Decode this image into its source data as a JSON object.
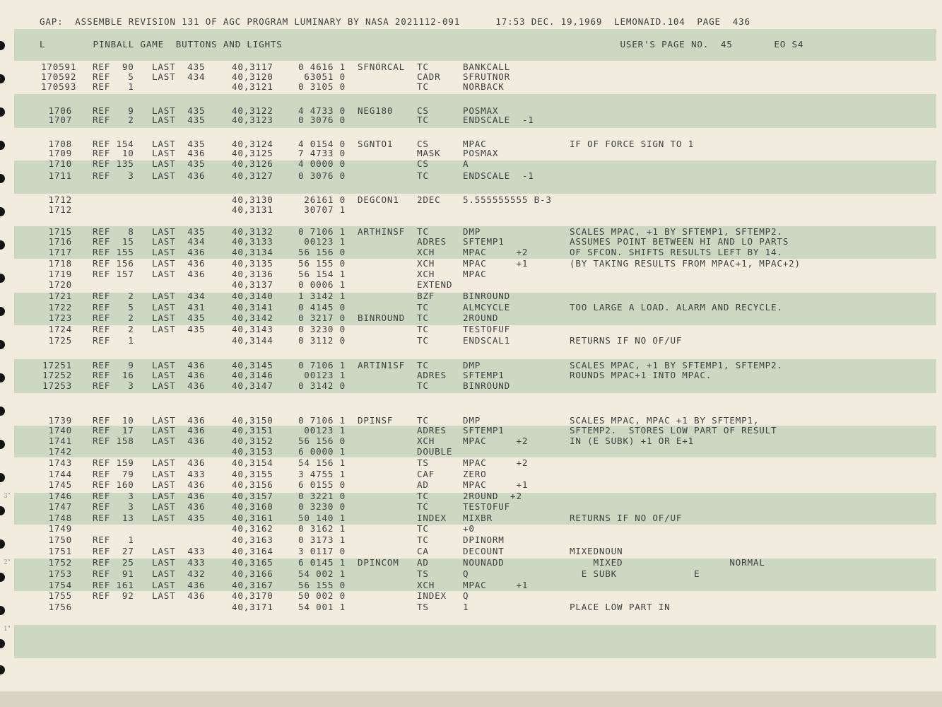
{
  "header": {
    "line": "GAP:  ASSEMBLE REVISION 131 OF AGC PROGRAM LUMINARY BY NASA 2021112-091      17:53 DEC. 19,1969  LEMONAID.104  PAGE  436"
  },
  "subheader": {
    "line": "L        PINBALL GAME  BUTTONS AND LIGHTS                                                         USER'S PAGE NO.  45       EO S4"
  },
  "rows": [
    {
      "seq": "170591",
      "ref": "REF  90",
      "last": "LAST  435",
      "addr": "40,3117",
      "code": "0 4616 1",
      "label": "SFNORCAL",
      "op": "TC",
      "operand": "BANKCALL",
      "comment": ""
    },
    {
      "seq": "170592",
      "ref": "REF   5",
      "last": "LAST  434",
      "addr": "40,3120",
      "code": "  63051 0",
      "label": "",
      "op": "CADR",
      "operand": "SFRUTNOR",
      "comment": ""
    },
    {
      "seq": "170593",
      "ref": "REF   1",
      "last": "",
      "addr": "40,3121",
      "code": "0 3105 0",
      "label": "",
      "op": "TC",
      "operand": "NORBACK",
      "comment": ""
    },
    {
      "seq": "1706",
      "ref": "REF   9",
      "last": "LAST  435",
      "addr": "40,3122",
      "code": "4 4733 0",
      "label": "NEG180",
      "op": "CS",
      "operand": "POSMAX",
      "comment": ""
    },
    {
      "seq": "1707",
      "ref": "REF   2",
      "last": "LAST  435",
      "addr": "40,3123",
      "code": "0 3076 0",
      "label": "",
      "op": "TC",
      "operand": "ENDSCALE  -1",
      "comment": ""
    },
    {
      "seq": "1708",
      "ref": "REF 154",
      "last": "LAST  435",
      "addr": "40,3124",
      "code": "4 0154 0",
      "label": "SGNTO1",
      "op": "CS",
      "operand": "MPAC",
      "comment": "IF OF FORCE SIGN TO 1"
    },
    {
      "seq": "1709",
      "ref": "REF  10",
      "last": "LAST  436",
      "addr": "40,3125",
      "code": "7 4733 0",
      "label": "",
      "op": "MASK",
      "operand": "POSMAX",
      "comment": ""
    },
    {
      "seq": "1710",
      "ref": "REF 135",
      "last": "LAST  435",
      "addr": "40,3126",
      "code": "4 0000 0",
      "label": "",
      "op": "CS",
      "operand": "A",
      "comment": ""
    },
    {
      "seq": "1711",
      "ref": "REF   3",
      "last": "LAST  436",
      "addr": "40,3127",
      "code": "0 3076 0",
      "label": "",
      "op": "TC",
      "operand": "ENDSCALE  -1",
      "comment": ""
    },
    {
      "seq": "1712",
      "ref": "",
      "last": "",
      "addr": "40,3130",
      "code": "  26161 0",
      "label": "DEGCON1",
      "op": "2DEC",
      "operand": "5.555555555 B-3",
      "comment": ""
    },
    {
      "seq": "1712",
      "ref": "",
      "last": "",
      "addr": "40,3131",
      "code": "  30707 1",
      "label": "",
      "op": "",
      "operand": "",
      "comment": ""
    },
    {
      "seq": "1715",
      "ref": "REF   8",
      "last": "LAST  435",
      "addr": "40,3132",
      "code": "0 7106 1",
      "label": "ARTHINSF",
      "op": "TC",
      "operand": "DMP",
      "comment": "SCALES MPAC, +1 BY SFTEMP1, SFTEMP2."
    },
    {
      "seq": "1716",
      "ref": "REF  15",
      "last": "LAST  434",
      "addr": "40,3133",
      "code": "  00123 1",
      "label": "",
      "op": "ADRES",
      "operand": "SFTEMP1",
      "comment": "ASSUMES POINT BETWEEN HI AND LO PARTS"
    },
    {
      "seq": "1717",
      "ref": "REF 155",
      "last": "LAST  436",
      "addr": "40,3134",
      "code": "56 156 0",
      "label": "",
      "op": "XCH",
      "operand": "MPAC     +2",
      "comment": "OF SFCON. SHIFTS RESULTS LEFT BY 14."
    },
    {
      "seq": "1718",
      "ref": "REF 156",
      "last": "LAST  436",
      "addr": "40,3135",
      "code": "56 155 0",
      "label": "",
      "op": "XCH",
      "operand": "MPAC     +1",
      "comment": "(BY TAKING RESULTS FROM MPAC+1, MPAC+2)"
    },
    {
      "seq": "1719",
      "ref": "REF 157",
      "last": "LAST  436",
      "addr": "40,3136",
      "code": "56 154 1",
      "label": "",
      "op": "XCH",
      "operand": "MPAC",
      "comment": ""
    },
    {
      "seq": "1720",
      "ref": "",
      "last": "",
      "addr": "40,3137",
      "code": "0 0006 1",
      "label": "",
      "op": "EXTEND",
      "operand": "",
      "comment": ""
    },
    {
      "seq": "1721",
      "ref": "REF   2",
      "last": "LAST  434",
      "addr": "40,3140",
      "code": "1 3142 1",
      "label": "",
      "op": "BZF",
      "operand": "BINROUND",
      "comment": ""
    },
    {
      "seq": "1722",
      "ref": "REF   5",
      "last": "LAST  431",
      "addr": "40,3141",
      "code": "0 4145 0",
      "label": "",
      "op": "TC",
      "operand": "ALMCYCLE",
      "comment": "TOO LARGE A LOAD. ALARM AND RECYCLE."
    },
    {
      "seq": "1723",
      "ref": "REF   2",
      "last": "LAST  435",
      "addr": "40,3142",
      "code": "0 3217 0",
      "label": "BINROUND",
      "op": "TC",
      "operand": "2ROUND",
      "comment": ""
    },
    {
      "seq": "1724",
      "ref": "REF   2",
      "last": "LAST  435",
      "addr": "40,3143",
      "code": "0 3230 0",
      "label": "",
      "op": "TC",
      "operand": "TESTOFUF",
      "comment": ""
    },
    {
      "seq": "1725",
      "ref": "REF   1",
      "last": "",
      "addr": "40,3144",
      "code": "0 3112 0",
      "label": "",
      "op": "TC",
      "operand": "ENDSCAL1",
      "comment": "RETURNS IF NO OF/UF"
    },
    {
      "seq": "17251",
      "ref": "REF   9",
      "last": "LAST  436",
      "addr": "40,3145",
      "code": "0 7106 1",
      "label": "ARTIN1SF",
      "op": "TC",
      "operand": "DMP",
      "comment": "SCALES MPAC, +1 BY SFTEMP1, SFTEMP2."
    },
    {
      "seq": "17252",
      "ref": "REF  16",
      "last": "LAST  436",
      "addr": "40,3146",
      "code": "  00123 1",
      "label": "",
      "op": "ADRES",
      "operand": "SFTEMP1",
      "comment": "ROUNDS MPAC+1 INTO MPAC."
    },
    {
      "seq": "17253",
      "ref": "REF   3",
      "last": "LAST  436",
      "addr": "40,3147",
      "code": "0 3142 0",
      "label": "",
      "op": "TC",
      "operand": "BINROUND",
      "comment": ""
    },
    {
      "seq": "1739",
      "ref": "REF  10",
      "last": "LAST  436",
      "addr": "40,3150",
      "code": "0 7106 1",
      "label": "DPINSF",
      "op": "TC",
      "operand": "DMP",
      "comment": "SCALES MPAC, MPAC +1 BY SFTEMP1,"
    },
    {
      "seq": "1740",
      "ref": "REF  17",
      "last": "LAST  436",
      "addr": "40,3151",
      "code": "  00123 1",
      "label": "",
      "op": "ADRES",
      "operand": "SFTEMP1",
      "comment": "SFTEMP2.  STORES LOW PART OF RESULT"
    },
    {
      "seq": "1741",
      "ref": "REF 158",
      "last": "LAST  436",
      "addr": "40,3152",
      "code": "56 156 0",
      "label": "",
      "op": "XCH",
      "operand": "MPAC     +2",
      "comment": "IN (E SUBK) +1 OR E+1"
    },
    {
      "seq": "1742",
      "ref": "",
      "last": "",
      "addr": "40,3153",
      "code": "6 0000 1",
      "label": "",
      "op": "DOUBLE",
      "operand": "",
      "comment": ""
    },
    {
      "seq": "1743",
      "ref": "REF 159",
      "last": "LAST  436",
      "addr": "40,3154",
      "code": "54 156 1",
      "label": "",
      "op": "TS",
      "operand": "MPAC     +2",
      "comment": ""
    },
    {
      "seq": "1744",
      "ref": "REF  79",
      "last": "LAST  433",
      "addr": "40,3155",
      "code": "3 4755 1",
      "label": "",
      "op": "CAF",
      "operand": "ZERO",
      "comment": ""
    },
    {
      "seq": "1745",
      "ref": "REF 160",
      "last": "LAST  436",
      "addr": "40,3156",
      "code": "6 0155 0",
      "label": "",
      "op": "AD",
      "operand": "MPAC     +1",
      "comment": ""
    },
    {
      "seq": "1746",
      "ref": "REF   3",
      "last": "LAST  436",
      "addr": "40,3157",
      "code": "0 3221 0",
      "label": "",
      "op": "TC",
      "operand": "2ROUND  +2",
      "comment": ""
    },
    {
      "seq": "1747",
      "ref": "REF   3",
      "last": "LAST  436",
      "addr": "40,3160",
      "code": "0 3230 0",
      "label": "",
      "op": "TC",
      "operand": "TESTOFUF",
      "comment": ""
    },
    {
      "seq": "1748",
      "ref": "REF  13",
      "last": "LAST  435",
      "addr": "40,3161",
      "code": "50 140 1",
      "label": "",
      "op": "INDEX",
      "operand": "MIXBR",
      "comment": "RETURNS IF NO OF/UF"
    },
    {
      "seq": "1749",
      "ref": "",
      "last": "",
      "addr": "40,3162",
      "code": "0 3162 1",
      "label": "",
      "op": "TC",
      "operand": "+0",
      "comment": ""
    },
    {
      "seq": "1750",
      "ref": "REF   1",
      "last": "",
      "addr": "40,3163",
      "code": "0 3173 1",
      "label": "",
      "op": "TC",
      "operand": "DPINORM",
      "comment": ""
    },
    {
      "seq": "1751",
      "ref": "REF  27",
      "last": "LAST  433",
      "addr": "40,3164",
      "code": "3 0117 0",
      "label": "",
      "op": "CA",
      "operand": "DECOUNT",
      "comment": "MIXEDNOUN"
    },
    {
      "seq": "1752",
      "ref": "REF  25",
      "last": "LAST  433",
      "addr": "40,3165",
      "code": "6 0145 1",
      "label": "DPINCOM",
      "op": "AD",
      "operand": "NOUNADD",
      "comment": "    MIXED                  NORMAL"
    },
    {
      "seq": "1753",
      "ref": "REF  91",
      "last": "LAST  432",
      "addr": "40,3166",
      "code": "54 002 1",
      "label": "",
      "op": "TS",
      "operand": "Q",
      "comment": "  E SUBK             E"
    },
    {
      "seq": "1754",
      "ref": "REF 161",
      "last": "LAST  436",
      "addr": "40,3167",
      "code": "56 155 0",
      "label": "",
      "op": "XCH",
      "operand": "MPAC     +1",
      "comment": ""
    },
    {
      "seq": "1755",
      "ref": "REF  92",
      "last": "LAST  436",
      "addr": "40,3170",
      "code": "50 002 0",
      "label": "",
      "op": "INDEX",
      "operand": "Q",
      "comment": ""
    },
    {
      "seq": "1756",
      "ref": "",
      "last": "",
      "addr": "40,3171",
      "code": "54 001 1",
      "label": "",
      "op": "TS",
      "operand": "1",
      "comment": "PLACE LOW PART IN"
    }
  ],
  "edge_marks": [
    "3\"",
    "2\"",
    "1\""
  ]
}
